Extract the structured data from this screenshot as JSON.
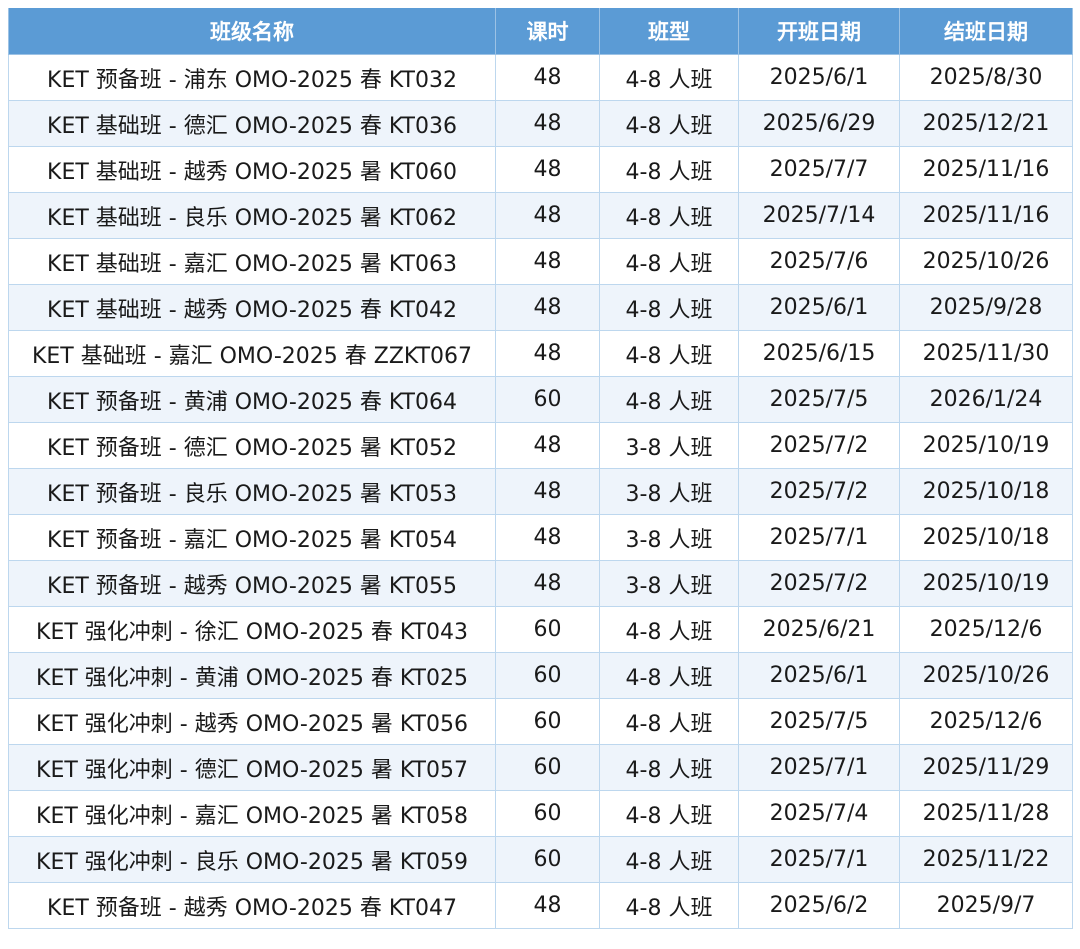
{
  "table": {
    "headers": [
      "班级名称",
      "课时",
      "班型",
      "开班日期",
      "结班日期"
    ],
    "rows": [
      [
        "KET 预备班 - 浦东 OMO-2025 春 KT032",
        "48",
        "4-8 人班",
        "2025/6/1",
        "2025/8/30"
      ],
      [
        "KET 基础班 - 德汇 OMO-2025 春 KT036",
        "48",
        "4-8 人班",
        "2025/6/29",
        "2025/12/21"
      ],
      [
        "KET 基础班 - 越秀 OMO-2025 暑 KT060",
        "48",
        "4-8 人班",
        "2025/7/7",
        "2025/11/16"
      ],
      [
        "KET 基础班 - 良乐 OMO-2025 暑 KT062",
        "48",
        "4-8 人班",
        "2025/7/14",
        "2025/11/16"
      ],
      [
        "KET 基础班 - 嘉汇 OMO-2025 暑 KT063",
        "48",
        "4-8 人班",
        "2025/7/6",
        "2025/10/26"
      ],
      [
        "KET 基础班 - 越秀 OMO-2025 春 KT042",
        "48",
        "4-8 人班",
        "2025/6/1",
        "2025/9/28"
      ],
      [
        "KET 基础班 - 嘉汇 OMO-2025 春 ZZKT067",
        "48",
        "4-8 人班",
        "2025/6/15",
        "2025/11/30"
      ],
      [
        "KET 预备班 - 黄浦 OMO-2025 春 KT064",
        "60",
        "4-8 人班",
        "2025/7/5",
        "2026/1/24"
      ],
      [
        "KET 预备班 - 德汇 OMO-2025 暑 KT052",
        "48",
        "3-8 人班",
        "2025/7/2",
        "2025/10/19"
      ],
      [
        "KET 预备班 - 良乐 OMO-2025 暑 KT053",
        "48",
        "3-8 人班",
        "2025/7/2",
        "2025/10/18"
      ],
      [
        "KET 预备班 - 嘉汇 OMO-2025 暑 KT054",
        "48",
        "3-8 人班",
        "2025/7/1",
        "2025/10/18"
      ],
      [
        "KET 预备班 - 越秀 OMO-2025 暑 KT055",
        "48",
        "3-8 人班",
        "2025/7/2",
        "2025/10/19"
      ],
      [
        "KET 强化冲刺 - 徐汇 OMO-2025 春 KT043",
        "60",
        "4-8 人班",
        "2025/6/21",
        "2025/12/6"
      ],
      [
        "KET 强化冲刺 - 黄浦 OMO-2025 春 KT025",
        "60",
        "4-8 人班",
        "2025/6/1",
        "2025/10/26"
      ],
      [
        "KET 强化冲刺 - 越秀 OMO-2025 暑 KT056",
        "60",
        "4-8 人班",
        "2025/7/5",
        "2025/12/6"
      ],
      [
        "KET 强化冲刺 - 德汇 OMO-2025 暑 KT057",
        "60",
        "4-8 人班",
        "2025/7/1",
        "2025/11/29"
      ],
      [
        "KET 强化冲刺 - 嘉汇 OMO-2025 暑 KT058",
        "60",
        "4-8 人班",
        "2025/7/4",
        "2025/11/28"
      ],
      [
        "KET 强化冲刺 - 良乐 OMO-2025 暑 KT059",
        "60",
        "4-8 人班",
        "2025/7/1",
        "2025/11/22"
      ],
      [
        "KET 预备班 - 越秀 OMO-2025 春 KT047",
        "48",
        "4-8 人班",
        "2025/6/2",
        "2025/9/7"
      ]
    ]
  },
  "colors": {
    "header_bg": "#5b9bd5",
    "header_text": "#ffffff",
    "row_alt_bg": "#eef4fb",
    "grid_line": "#bdd7ee"
  }
}
